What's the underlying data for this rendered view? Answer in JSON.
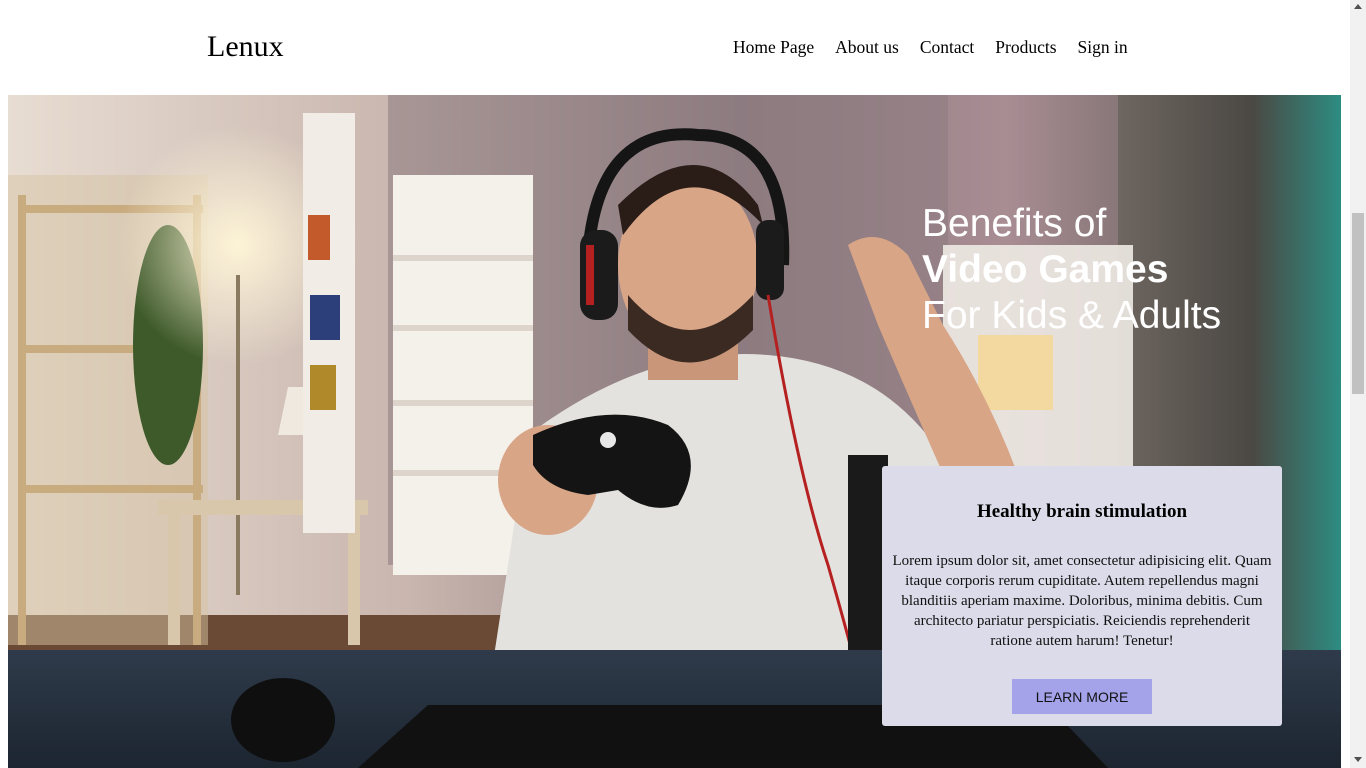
{
  "brand": {
    "logo": "Lenux"
  },
  "nav": {
    "items": [
      {
        "label": "Home Page"
      },
      {
        "label": "About us"
      },
      {
        "label": "Contact"
      },
      {
        "label": "Products"
      },
      {
        "label": "Sign in"
      }
    ]
  },
  "hero": {
    "headline_line1": "Benefits of",
    "headline_line2": "Video Games",
    "headline_line3": "For Kids & Adults",
    "image": "man-gaming-with-controller-and-headphones"
  },
  "card": {
    "title": "Healthy brain stimulation",
    "text": "Lorem ipsum dolor sit, amet consectetur adipisicing elit. Quam itaque corporis rerum cupiditate. Autem repellendus magni blanditiis aperiam maxime. Doloribus, minima debitis. Cum architecto pariatur perspiciatis. Reiciendis reprehenderit ratione autem harum! Tenetur!",
    "button_label": "LEARN MORE",
    "button_color": "#a4a3ea",
    "background": "#dcdbe9"
  }
}
